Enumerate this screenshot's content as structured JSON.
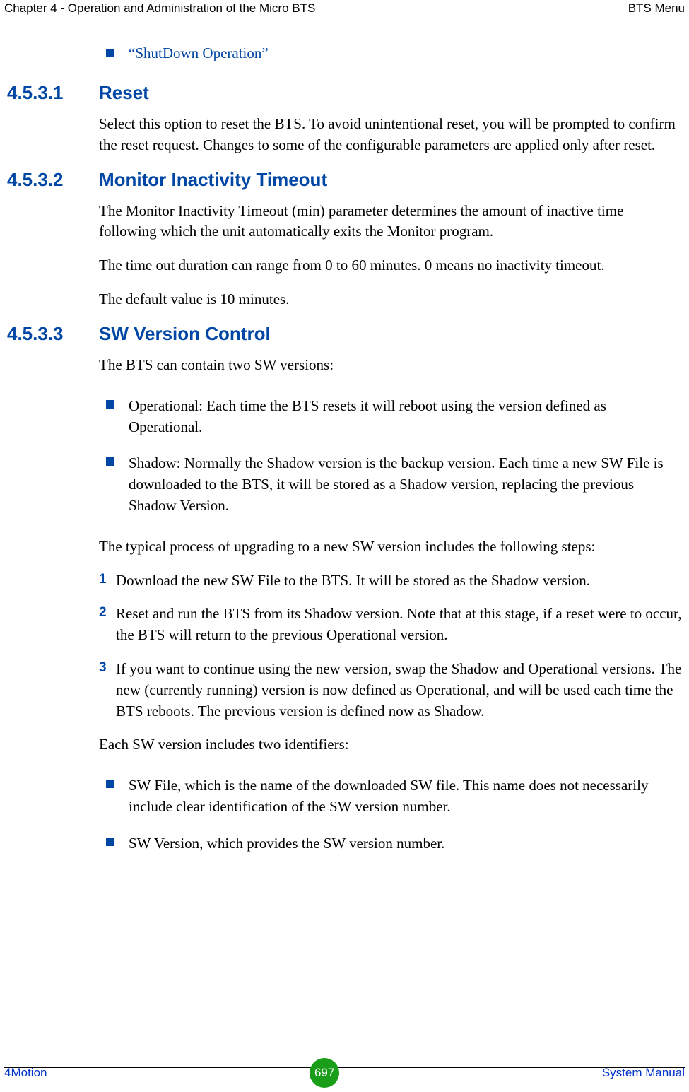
{
  "header": {
    "left": "Chapter 4 - Operation and Administration of the Micro BTS",
    "right": "BTS Menu"
  },
  "xref_bullet": "“ShutDown Operation”",
  "sections": [
    {
      "num": "4.5.3.1",
      "title": "Reset",
      "paras": [
        "Select this option to reset the BTS. To avoid unintentional reset, you will be prompted to confirm the reset request. Changes to some of the configurable parameters are applied only after reset."
      ]
    },
    {
      "num": "4.5.3.2",
      "title": "Monitor Inactivity Timeout",
      "paras": [
        "The Monitor Inactivity Timeout (min) parameter determines the amount of inactive time following which the unit automatically exits the Monitor program.",
        "The time out duration can range from 0 to 60 minutes. 0 means no inactivity timeout.",
        "The default value is 10 minutes."
      ]
    },
    {
      "num": "4.5.3.3",
      "title": "SW Version Control",
      "intro": "The BTS can contain two SW versions:",
      "bullets1": [
        "Operational: Each time the BTS resets it will reboot using the version defined as Operational.",
        "Shadow: Normally the Shadow version is the backup version. Each time a new SW File is downloaded to the BTS, it will be stored as a Shadow version, replacing the previous Shadow Version."
      ],
      "mid": "The typical process of upgrading to a new SW version includes the following steps:",
      "steps": [
        "Download the new SW File to the BTS. It will be stored as the Shadow version.",
        "Reset and run the BTS from its Shadow version. Note that at this stage, if a reset were to occur, the BTS will return to the previous Operational version.",
        "If you want to continue using the new version, swap the Shadow and Operational versions. The new (currently running) version is now defined as Operational, and will be used each time the BTS reboots. The previous version is defined now as Shadow."
      ],
      "mid2": "Each SW version includes two identifiers:",
      "bullets2": [
        "SW File, which is the name of the downloaded SW file. This name does not necessarily include clear identification of the SW version number.",
        "SW Version, which provides the SW version number."
      ]
    }
  ],
  "footer": {
    "left": "4Motion",
    "page": "697",
    "right": "System Manual"
  }
}
